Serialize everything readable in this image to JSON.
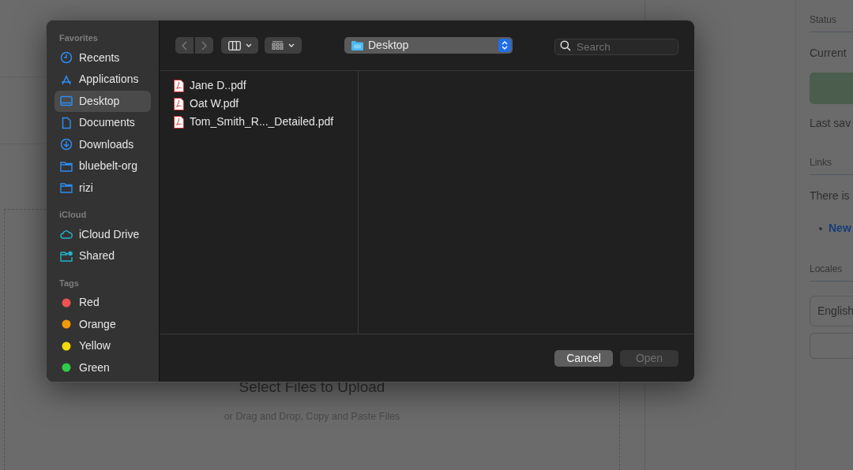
{
  "background": {
    "upload_title": "Select Files to Upload",
    "upload_hint": "or Drag and Drop, Copy and Paste Files",
    "side_panel": {
      "status_heading": "Status",
      "current_label": "Current",
      "last_saved": "Last sav",
      "links_heading": "Links",
      "links_text": "There is",
      "link": "New",
      "locales_heading": "Locales",
      "locale_field": "English"
    }
  },
  "dialog": {
    "toolbar": {
      "location": "Desktop",
      "search_placeholder": "Search"
    },
    "sidebar": [
      {
        "heading": "Favorites",
        "items": [
          {
            "label": "Recents",
            "kind": "clock",
            "selected": false
          },
          {
            "label": "Applications",
            "kind": "apps",
            "selected": false
          },
          {
            "label": "Desktop",
            "kind": "desktop",
            "selected": true
          },
          {
            "label": "Documents",
            "kind": "document",
            "selected": false
          },
          {
            "label": "Downloads",
            "kind": "download",
            "selected": false
          },
          {
            "label": "bluebelt-org",
            "kind": "folder",
            "selected": false
          },
          {
            "label": "rizi",
            "kind": "folder",
            "selected": false
          }
        ]
      },
      {
        "heading": "iCloud",
        "items": [
          {
            "label": "iCloud Drive",
            "kind": "cloud",
            "selected": false
          },
          {
            "label": "Shared",
            "kind": "shared",
            "selected": false
          }
        ]
      },
      {
        "heading": "Tags",
        "items": [
          {
            "label": "Red",
            "kind": "tag",
            "color": "#ec5352",
            "selected": false
          },
          {
            "label": "Orange",
            "kind": "tag",
            "color": "#f09a0a",
            "selected": false
          },
          {
            "label": "Yellow",
            "kind": "tag",
            "color": "#f5d90a",
            "selected": false
          },
          {
            "label": "Green",
            "kind": "tag",
            "color": "#31c947",
            "selected": false
          }
        ]
      }
    ],
    "files": [
      "Jane D..pdf",
      "Oat W.pdf",
      "Tom_Smith_R..._Detailed.pdf"
    ],
    "buttons": [
      {
        "label": "Cancel",
        "disabled": false
      },
      {
        "label": "Open",
        "disabled": true
      }
    ]
  }
}
